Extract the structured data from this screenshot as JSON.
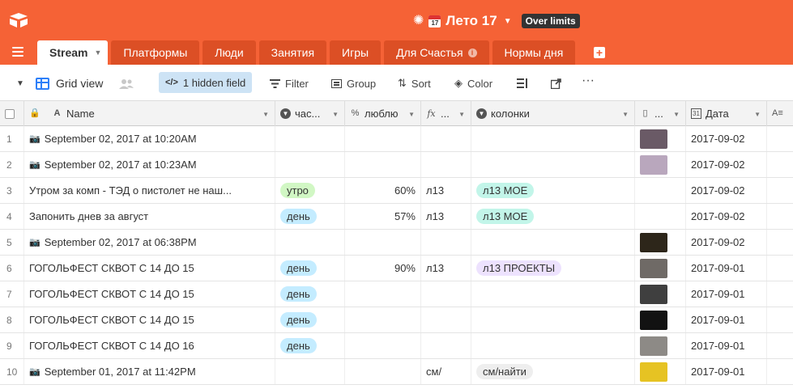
{
  "app": {
    "base_title": "Лето 17",
    "over_limits_badge": "Over limits"
  },
  "tabs": [
    {
      "label": "Stream",
      "active": true
    },
    {
      "label": "Платформы"
    },
    {
      "label": "Люди"
    },
    {
      "label": "Занятия"
    },
    {
      "label": "Игры"
    },
    {
      "label": "Для Счастья",
      "info_icon": true
    },
    {
      "label": "Нормы дня"
    }
  ],
  "toolbar": {
    "view_name": "Grid view",
    "hidden_fields": "1 hidden field",
    "filter": "Filter",
    "group": "Group",
    "sort": "Sort",
    "color": "Color"
  },
  "columns": {
    "name": "Name",
    "part_of_day": "час...",
    "like": "люблю",
    "formula": "...",
    "columns_field": "колонки",
    "attachment": "...",
    "date": "Дата"
  },
  "rows": [
    {
      "n": "1",
      "name": "September 02, 2017 at 10:20AM",
      "cam": true,
      "part": "",
      "like": "",
      "formula": "",
      "col": "",
      "thumb": "#6a5a66",
      "date": "2017-09-02"
    },
    {
      "n": "2",
      "name": "September 02, 2017 at 10:23AM",
      "cam": true,
      "part": "",
      "like": "",
      "formula": "",
      "col": "",
      "thumb": "#b9a7bd",
      "date": "2017-09-02"
    },
    {
      "n": "3",
      "name": "Утром за комп - ТЭД о пистолет не наш...",
      "cam": false,
      "part": "утро",
      "part_color": "#d1f7c4",
      "like": "60%",
      "formula": "л13",
      "col": "л13 МОЕ",
      "col_color": "#c2f5e9",
      "thumb": "",
      "date": "2017-09-02"
    },
    {
      "n": "4",
      "name": "Запонить днев за август",
      "cam": false,
      "part": "день",
      "part_color": "#c4ecff",
      "like": "57%",
      "formula": "л13",
      "col": "л13 МОЕ",
      "col_color": "#c2f5e9",
      "thumb": "",
      "date": "2017-09-02"
    },
    {
      "n": "5",
      "name": "September 02, 2017 at 06:38PM",
      "cam": true,
      "part": "",
      "like": "",
      "formula": "",
      "col": "",
      "thumb": "#2d261a",
      "date": "2017-09-02"
    },
    {
      "n": "6",
      "name": "ГОГОЛЬФЕСТ СКВОТ С 14 ДО 15",
      "cam": false,
      "part": "день",
      "part_color": "#c4ecff",
      "like": "90%",
      "formula": "л13",
      "col": "л13 ПРОЕКТЫ",
      "col_color": "#ede2fe",
      "thumb": "#6f6a66",
      "date": "2017-09-01"
    },
    {
      "n": "7",
      "name": "ГОГОЛЬФЕСТ СКВОТ С 14 ДО 15",
      "cam": false,
      "part": "день",
      "part_color": "#c4ecff",
      "like": "",
      "formula": "",
      "col": "",
      "thumb": "#3f3f3f",
      "date": "2017-09-01"
    },
    {
      "n": "8",
      "name": "ГОГОЛЬФЕСТ СКВОТ С 14 ДО 15",
      "cam": false,
      "part": "день",
      "part_color": "#c4ecff",
      "like": "",
      "formula": "",
      "col": "",
      "thumb": "#121212",
      "date": "2017-09-01"
    },
    {
      "n": "9",
      "name": "ГОГОЛЬФЕСТ СКВОТ С 14 ДО 16",
      "cam": false,
      "part": "день",
      "part_color": "#c4ecff",
      "like": "",
      "formula": "",
      "col": "",
      "thumb": "#8d8a86",
      "date": "2017-09-01"
    },
    {
      "n": "10",
      "name": "September 01, 2017 at 11:42PM",
      "cam": true,
      "part": "",
      "like": "",
      "formula": "см/",
      "col": "см/найти",
      "col_color": "#eeeeee",
      "thumb": "#e6c323",
      "date": "2017-09-01"
    }
  ]
}
